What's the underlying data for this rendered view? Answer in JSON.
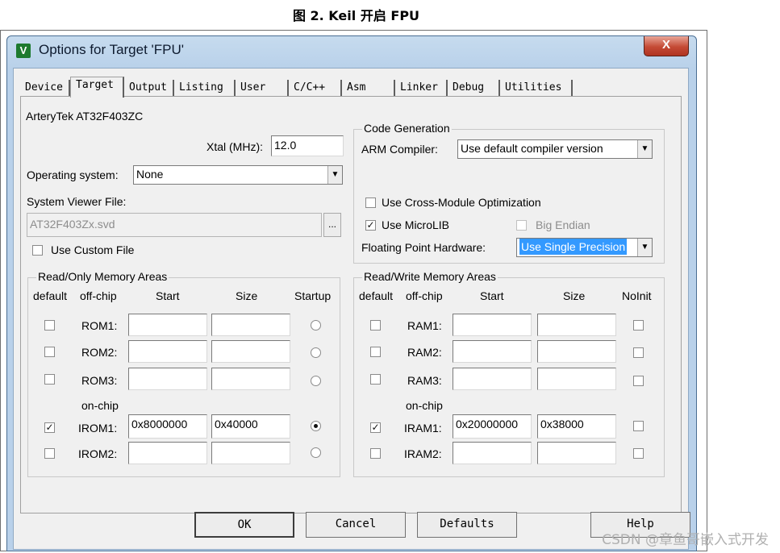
{
  "caption": "图 2. Keil 开启 FPU",
  "window": {
    "app_icon_glyph": "V",
    "title": "Options for Target 'FPU'",
    "close_glyph": "X"
  },
  "tabs": [
    {
      "label": "Device"
    },
    {
      "label": "Target",
      "active": true
    },
    {
      "label": "Output"
    },
    {
      "label": "Listing"
    },
    {
      "label": "User"
    },
    {
      "label": "C/C++"
    },
    {
      "label": "Asm"
    },
    {
      "label": "Linker"
    },
    {
      "label": "Debug"
    },
    {
      "label": "Utilities"
    }
  ],
  "target": {
    "device_name": "ArteryTek AT32F403ZC",
    "xtal_label": "Xtal (MHz):",
    "xtal_value": "12.0",
    "os_label": "Operating system:",
    "os_value": "None",
    "svf_label": "System Viewer File:",
    "svf_value": "AT32F403Zx.svd",
    "browse_label": "...",
    "use_custom_file_label": "Use Custom File",
    "use_custom_file_checked": false
  },
  "code_generation": {
    "group_title": "Code Generation",
    "arm_compiler_label": "ARM Compiler:",
    "arm_compiler_value": "Use default compiler version",
    "cross_module_label": "Use Cross-Module Optimization",
    "cross_module_checked": false,
    "microlib_label": "Use MicroLIB",
    "microlib_checked": true,
    "big_endian_label": "Big Endian",
    "big_endian_checked": false,
    "fph_label": "Floating Point Hardware:",
    "fph_value": "Use Single Precision"
  },
  "ro_memory": {
    "group_title": "Read/Only Memory Areas",
    "headers": {
      "default": "default",
      "offchip": "off-chip",
      "start": "Start",
      "size": "Size",
      "startup": "Startup"
    },
    "onchip_label": "on-chip",
    "rows": [
      {
        "name": "ROM1:",
        "start": "",
        "size": "",
        "default": false,
        "startup": false
      },
      {
        "name": "ROM2:",
        "start": "",
        "size": "",
        "default": false,
        "startup": false
      },
      {
        "name": "ROM3:",
        "start": "",
        "size": "",
        "default": false,
        "startup": false
      },
      {
        "name": "IROM1:",
        "start": "0x8000000",
        "size": "0x40000",
        "default": true,
        "startup": true
      },
      {
        "name": "IROM2:",
        "start": "",
        "size": "",
        "default": false,
        "startup": false
      }
    ]
  },
  "rw_memory": {
    "group_title": "Read/Write Memory Areas",
    "headers": {
      "default": "default",
      "offchip": "off-chip",
      "start": "Start",
      "size": "Size",
      "noinit": "NoInit"
    },
    "onchip_label": "on-chip",
    "rows": [
      {
        "name": "RAM1:",
        "start": "",
        "size": "",
        "default": false,
        "noinit": false
      },
      {
        "name": "RAM2:",
        "start": "",
        "size": "",
        "default": false,
        "noinit": false
      },
      {
        "name": "RAM3:",
        "start": "",
        "size": "",
        "default": false,
        "noinit": false
      },
      {
        "name": "IRAM1:",
        "start": "0x20000000",
        "size": "0x38000",
        "default": true,
        "noinit": false
      },
      {
        "name": "IRAM2:",
        "start": "",
        "size": "",
        "default": false,
        "noinit": false
      }
    ]
  },
  "buttons": {
    "ok": "OK",
    "cancel": "Cancel",
    "defaults": "Defaults",
    "help": "Help"
  },
  "watermark": "CSDN @章鱼哥嵌入式开发"
}
